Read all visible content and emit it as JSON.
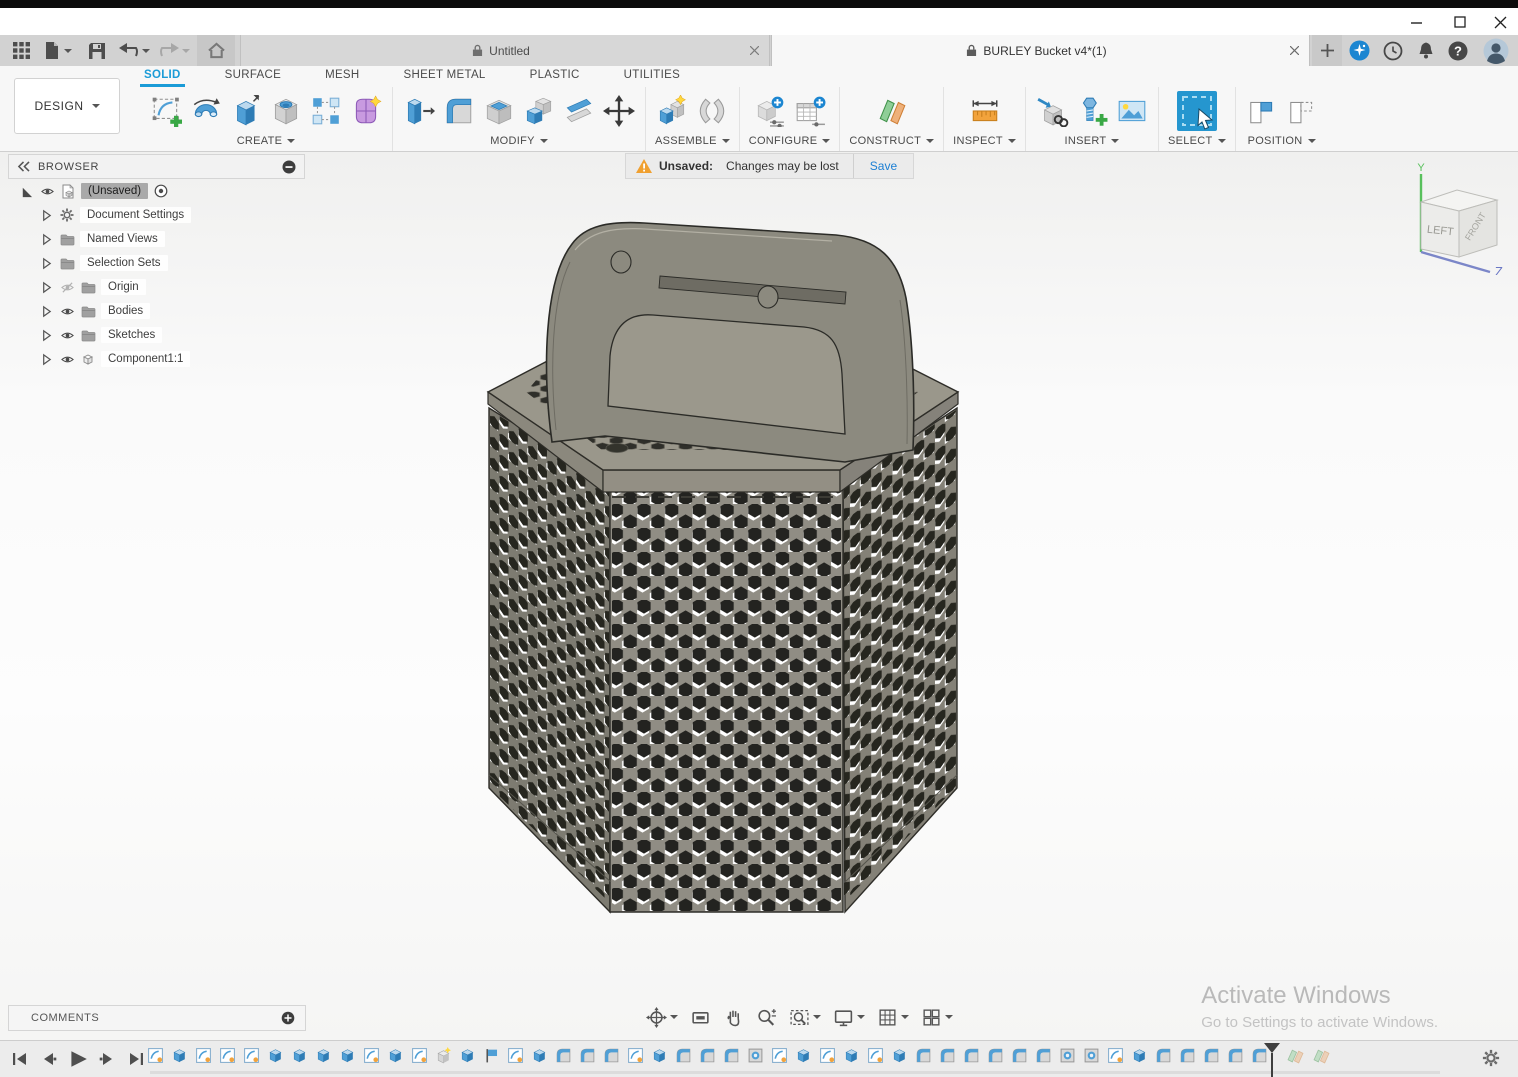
{
  "doc_tabs": {
    "inactive": {
      "title": "Untitled"
    },
    "active": {
      "title": "BURLEY Bucket v4*(1)"
    }
  },
  "ribbon": {
    "design": "DESIGN",
    "tabs": [
      {
        "label": "SOLID",
        "active": true
      },
      {
        "label": "SURFACE",
        "active": false
      },
      {
        "label": "MESH",
        "active": false
      },
      {
        "label": "SHEET METAL",
        "active": false
      },
      {
        "label": "PLASTIC",
        "active": false
      },
      {
        "label": "UTILITIES",
        "active": false
      }
    ],
    "groups": [
      {
        "label": "CREATE",
        "tools": [
          "create-sketch",
          "revolve",
          "extrude",
          "hole",
          "pattern",
          "form"
        ]
      },
      {
        "label": "MODIFY",
        "tools": [
          "press-pull",
          "fillet",
          "shell",
          "combine",
          "split",
          "move"
        ]
      },
      {
        "label": "ASSEMBLE",
        "tools": [
          "new-component",
          "joint"
        ]
      },
      {
        "label": "CONFIGURE",
        "tools": [
          "configuration",
          "config-table"
        ]
      },
      {
        "label": "CONSTRUCT",
        "tools": [
          "construct-plane"
        ]
      },
      {
        "label": "INSPECT",
        "tools": [
          "measure"
        ]
      },
      {
        "label": "INSERT",
        "tools": [
          "insert-derive",
          "insert-fastener",
          "canvas-image"
        ]
      },
      {
        "label": "SELECT",
        "tools": [
          "select"
        ]
      },
      {
        "label": "POSITION",
        "tools": [
          "capture-position",
          "revert-position"
        ]
      }
    ]
  },
  "warning": {
    "label": "Unsaved:",
    "message": "Changes may be lost",
    "save": "Save"
  },
  "browser": {
    "title": "BROWSER",
    "root_label": "(Unsaved)",
    "items": [
      {
        "label": "Document Settings",
        "icon": "gear",
        "eye": null
      },
      {
        "label": "Named Views",
        "icon": "folder",
        "eye": null
      },
      {
        "label": "Selection Sets",
        "icon": "folder",
        "eye": null
      },
      {
        "label": "Origin",
        "icon": "folder",
        "eye": "hidden"
      },
      {
        "label": "Bodies",
        "icon": "folder",
        "eye": "visible"
      },
      {
        "label": "Sketches",
        "icon": "folder",
        "eye": "visible"
      },
      {
        "label": "Component1:1",
        "icon": "component",
        "eye": "visible"
      }
    ]
  },
  "viewcube": {
    "front_face": "LEFT",
    "side_face": "FRONT",
    "axis_y": "Y",
    "axis_z": "Z"
  },
  "comments_label": "COMMENTS",
  "nav": {
    "items": [
      {
        "name": "orbit",
        "caret": true
      },
      {
        "name": "look-at",
        "caret": false
      },
      {
        "name": "pan",
        "caret": false
      },
      {
        "name": "zoom",
        "caret": false
      },
      {
        "name": "fit",
        "caret": true
      },
      {
        "name": "display-settings",
        "caret": true
      },
      {
        "name": "grid-display",
        "caret": true
      },
      {
        "name": "viewports",
        "caret": true
      }
    ]
  },
  "timeline": {
    "features": [
      "sketch",
      "extrude",
      "sketch",
      "sketch",
      "sketch",
      "extrude",
      "extrude",
      "extrude",
      "extrude",
      "sketch",
      "extrude",
      "sketch",
      "feature",
      "extrude",
      "flag",
      "sketch",
      "extrude",
      "fillet",
      "fillet",
      "fillet",
      "sketch",
      "extrude",
      "fillet",
      "fillet",
      "fillet",
      "hole",
      "sketch",
      "extrude",
      "sketch",
      "extrude",
      "sketch",
      "extrude",
      "fillet",
      "fillet",
      "fillet",
      "fillet",
      "fillet",
      "fillet",
      "hole",
      "hole",
      "sketch",
      "extrude",
      "fillet",
      "fillet",
      "fillet",
      "fillet",
      "fillet"
    ],
    "ghost_features": [
      "plane",
      "plane"
    ]
  },
  "watermark": {
    "line1": "Activate Windows",
    "line2": "Go to Settings to activate Windows."
  },
  "colors": {
    "accent": "#1a9bd7",
    "save_link": "#1b7fd4",
    "warning": "#f0a030",
    "model_gray": "#8f8d84"
  }
}
